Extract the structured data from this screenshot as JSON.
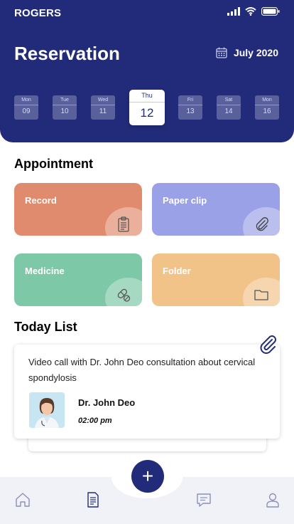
{
  "status_bar": {
    "carrier": "ROGERS"
  },
  "header": {
    "title": "Reservation",
    "month": "July 2020",
    "days": [
      {
        "day": "Mon",
        "num": "09"
      },
      {
        "day": "Tue",
        "num": "10"
      },
      {
        "day": "Wed",
        "num": "11"
      },
      {
        "day": "Thu",
        "num": "12"
      },
      {
        "day": "Fri",
        "num": "13"
      },
      {
        "day": "Sat",
        "num": "14"
      },
      {
        "day": "Mon",
        "num": "16"
      }
    ]
  },
  "appointment": {
    "title": "Appointment",
    "cards": [
      {
        "label": "Record",
        "color": "#e08b6e",
        "icon": "clipboard-icon"
      },
      {
        "label": "Paper clip",
        "color": "#9ba1e6",
        "icon": "paper-clip-icon"
      },
      {
        "label": "Medicine",
        "color": "#7dc8a6",
        "icon": "pill-icon"
      },
      {
        "label": "Folder",
        "color": "#f2c389",
        "icon": "folder-icon"
      }
    ]
  },
  "today": {
    "title": "Today List",
    "item": {
      "description": "Video call with Dr. John Deo consultation about cervical spondylosis",
      "doctor": "Dr. John Deo",
      "time": "02:00 pm"
    }
  },
  "nav": {
    "items": [
      "home-icon",
      "document-icon",
      "chat-icon",
      "profile-icon"
    ],
    "fab": "+"
  },
  "colors": {
    "primary": "#222b7a"
  }
}
